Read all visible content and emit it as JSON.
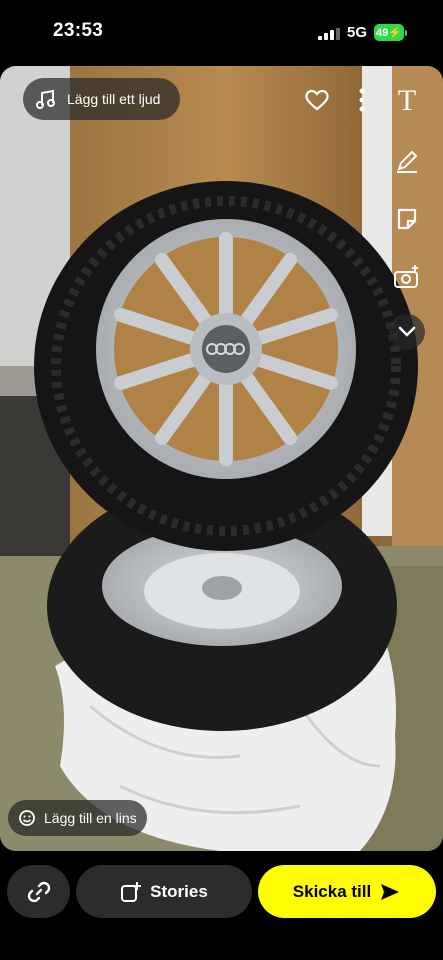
{
  "status": {
    "time": "23:53",
    "network": "5G",
    "battery": "49"
  },
  "top": {
    "add_sound": "Lägg till ett ljud"
  },
  "toolbar": {
    "text_tool": "T"
  },
  "lens": {
    "label": "Lägg till en lins"
  },
  "bottom": {
    "stories": "Stories",
    "send": "Skicka till"
  },
  "colors": {
    "accent": "#fffc00",
    "pill": "#2c2c2e",
    "battery": "#32d74b"
  },
  "icons": [
    "music-note-icon",
    "heart-icon",
    "more-vertical-icon",
    "text-icon",
    "pencil-icon",
    "sticker-icon",
    "camera-plus-icon",
    "chevron-down-icon",
    "lens-icon",
    "link-icon",
    "story-add-icon",
    "send-arrow-icon"
  ]
}
